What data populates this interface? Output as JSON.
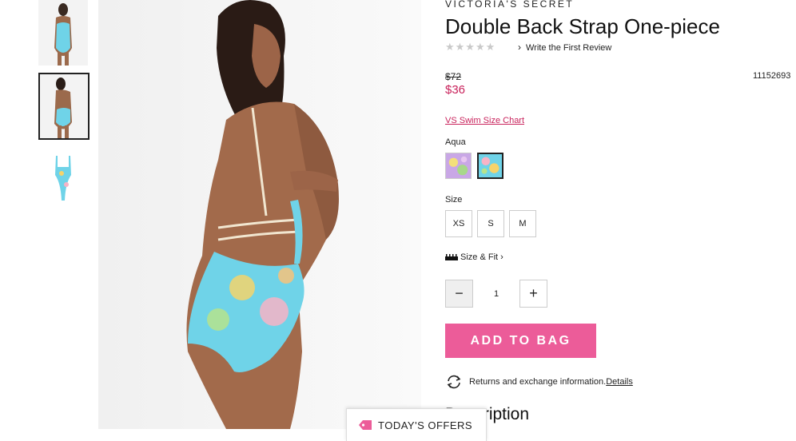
{
  "brand": "VICTORIA'S SECRET",
  "product": {
    "title": "Double Back Strap One-piece",
    "stars": "★★★★★",
    "review_link": "Write the First Review",
    "original_price": "$72",
    "sale_price": "$36",
    "sku": "11152693",
    "size_chart_link": "VS Swim Size Chart",
    "selected_color": "Aqua",
    "size_label": "Size",
    "sizes": [
      "XS",
      "S",
      "M"
    ],
    "size_fit_label": "Size & Fit",
    "quantity": "1",
    "add_to_bag": "ADD TO BAG",
    "returns_text": "Returns and exchange information.",
    "returns_link": "Details",
    "description_heading": "Description"
  },
  "offers_tab": "TODAY'S OFFERS",
  "colors": {
    "accent_pink": "#c9235c",
    "button_pink": "#ec5c99",
    "aqua": "#5fd3ea"
  }
}
